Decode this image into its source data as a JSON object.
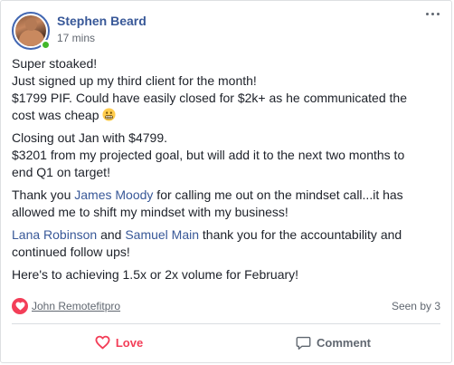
{
  "post": {
    "author": "Stephen Beard",
    "timestamp": "17 mins",
    "more_icon": "more-horizontal-icon",
    "paragraphs": [
      {
        "lines": [
          "Super stoaked!",
          "Just signed up my third client for the month!",
          "$1799 PIF. Could have easily closed for $2k+ as he communicated the",
          "cost was cheap"
        ],
        "trailing_emoji": "grimacing-emoji"
      },
      {
        "lines": [
          "Closing out Jan with $4799.",
          "$3201 from my projected goal, but will add it to the next two months to",
          "end Q1 on target!"
        ]
      },
      {
        "pre": "Thank you ",
        "mention": "James Moody",
        "post": " for calling me out on the mindset call...it has",
        "line2": "allowed me to shift my mindset with my business!"
      },
      {
        "mention1": "Lana Robinson",
        "mid": " and ",
        "mention2": "Samuel Main",
        "post": " thank you for the accountability and",
        "line2": "continued follow ups!"
      },
      {
        "text": "Here's to achieving 1.5x or 2x volume for February!"
      }
    ]
  },
  "reactions": {
    "icon": "love-reaction-icon",
    "reactor": "John Remotefitpro",
    "seen_by": "Seen by 3"
  },
  "actions": {
    "love_label": "Love",
    "comment_label": "Comment"
  },
  "colors": {
    "link": "#385898",
    "love": "#f33e58",
    "online": "#42b72a",
    "muted": "#606770"
  }
}
